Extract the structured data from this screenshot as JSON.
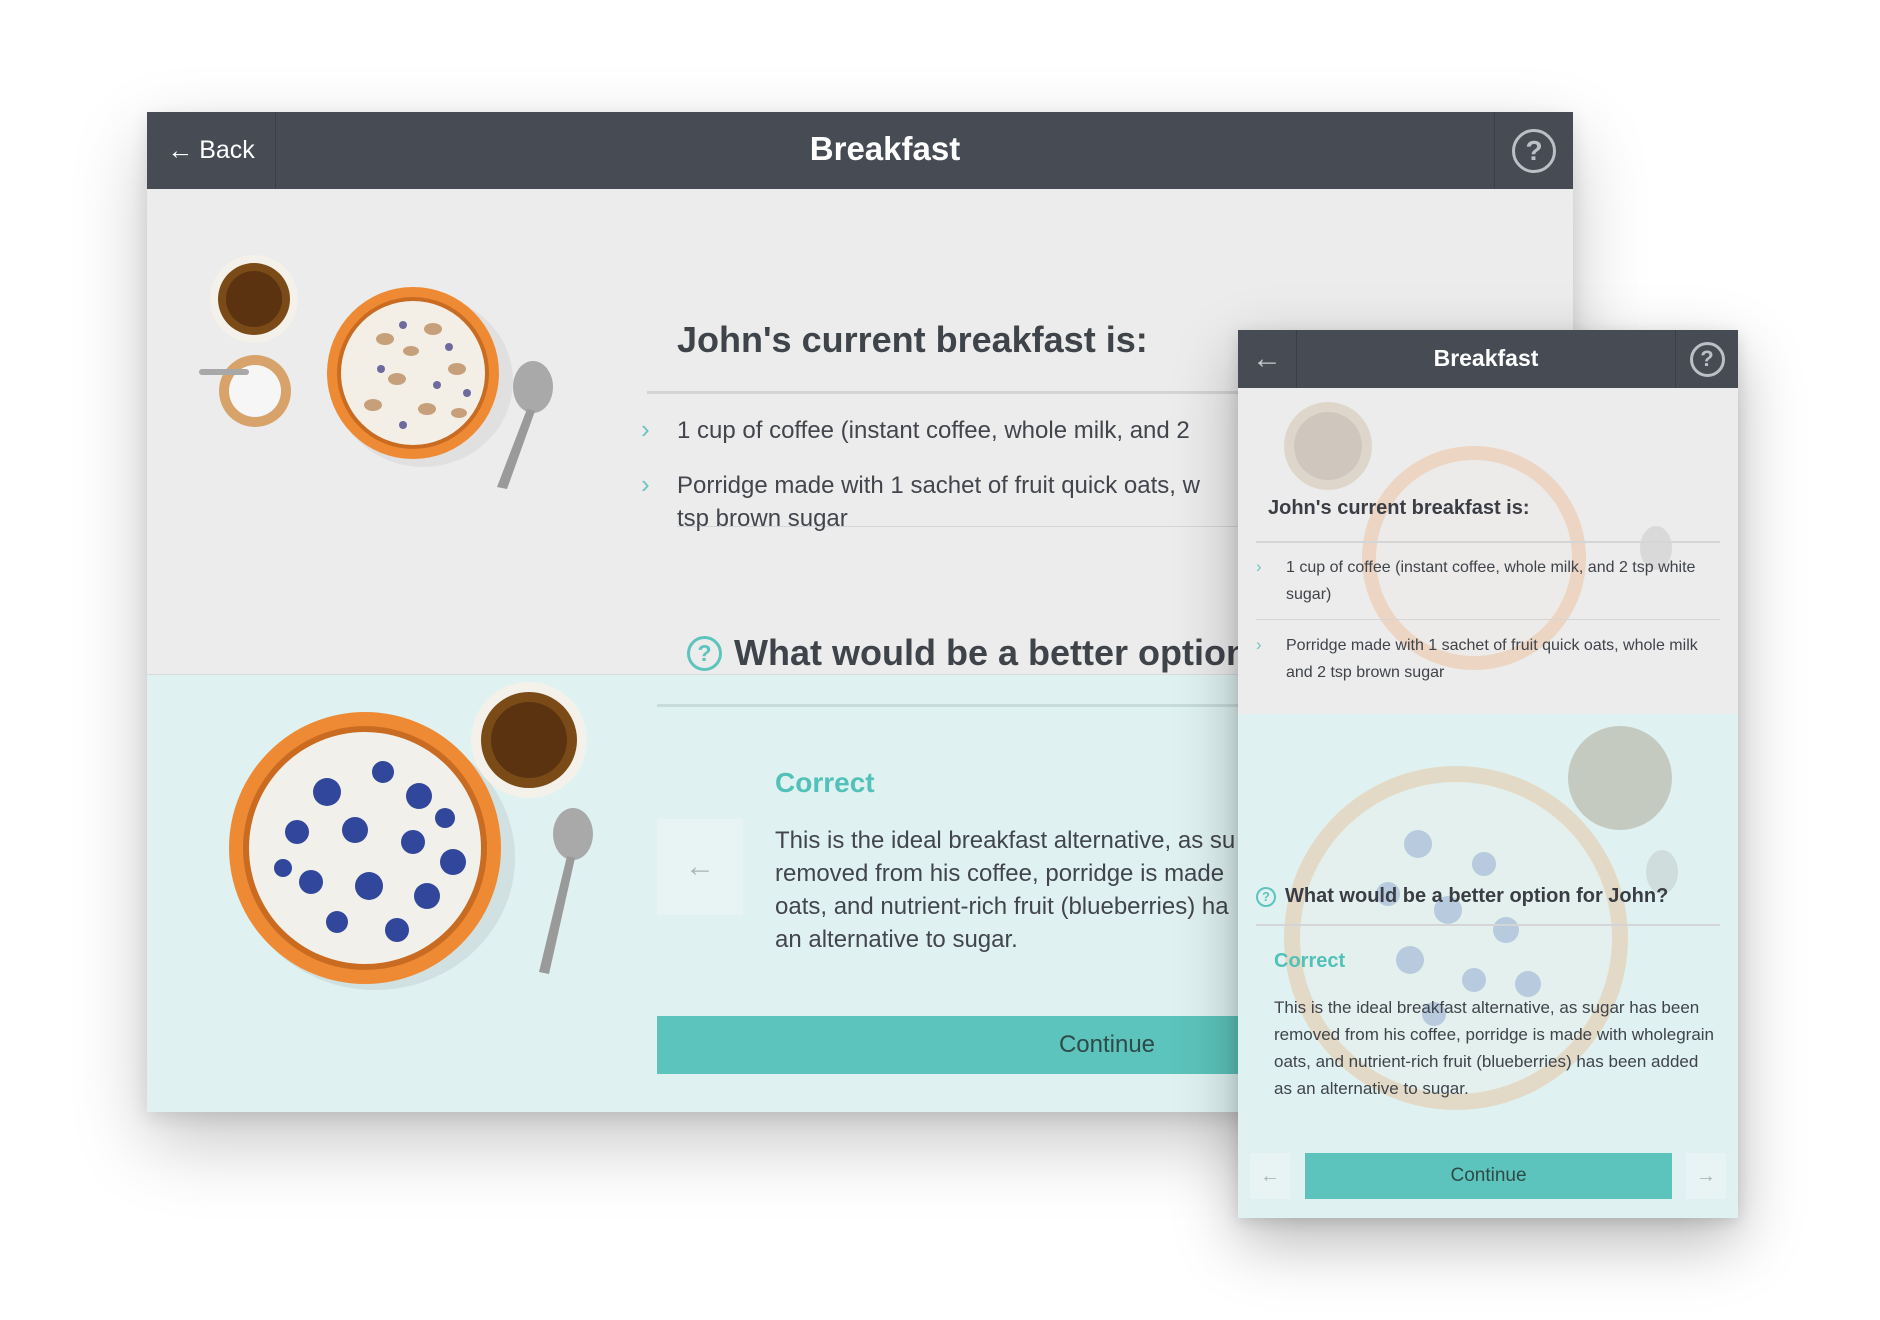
{
  "desktop": {
    "back_label": "Back",
    "title": "Breakfast",
    "help_glyph": "?",
    "current_heading": "John's current breakfast is:",
    "items": [
      "1 cup of coffee (instant coffee, whole milk, and 2",
      "Porridge made with 1 sachet of fruit quick oats, w",
      "tsp brown sugar"
    ],
    "question": "What would be a better option f",
    "result_label": "Correct",
    "feedback_lines": [
      "This is the ideal breakfast alternative, as su",
      "removed from his coffee, porridge is made",
      "oats, and nutrient-rich fruit (blueberries) ha",
      "an alternative to sugar."
    ],
    "continue_label": "Continue"
  },
  "mobile": {
    "title": "Breakfast",
    "help_glyph": "?",
    "current_heading": "John's current breakfast is:",
    "items": [
      "1 cup of coffee (instant coffee, whole milk, and 2 tsp white sugar)",
      "Porridge made with 1 sachet of fruit quick oats, whole milk and 2 tsp brown sugar"
    ],
    "question": "What would be a better option for John?",
    "result_label": "Correct",
    "feedback": "This is the ideal breakfast alternative, as sugar has been removed from his coffee, porridge is made with wholegrain oats, and nutrient-rich fruit (blueberries) has been added as an alternative to sugar.",
    "continue_label": "Continue"
  },
  "icons": {
    "back": "arrow-left-icon",
    "help": "help-circle-icon",
    "chevron": "chevron-right-icon",
    "prev": "arrow-left-icon",
    "next": "arrow-right-icon",
    "question": "question-circle-icon"
  },
  "colors": {
    "header": "#474c54",
    "accent": "#5cc4bc",
    "upper_bg": "#ececec",
    "lower_bg": "#dff2f1"
  }
}
